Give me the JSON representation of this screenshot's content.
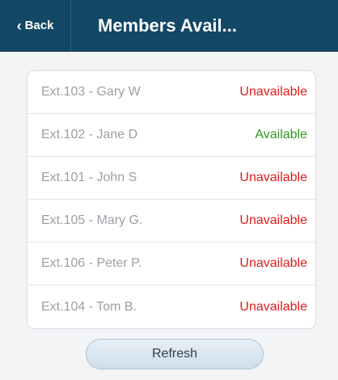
{
  "header": {
    "back_label": "Back",
    "back_glyph": "‹",
    "title": "Members Avail..."
  },
  "members": [
    {
      "name": "Ext.103 - Gary W",
      "status": "Unavailable",
      "status_color": "#e11c1c"
    },
    {
      "name": "Ext.102 - Jane D",
      "status": "Available",
      "status_color": "#2f9a1c"
    },
    {
      "name": "Ext.101 - John S",
      "status": "Unavailable",
      "status_color": "#e11c1c"
    },
    {
      "name": "Ext.105 - Mary G.",
      "status": "Unavailable",
      "status_color": "#e11c1c"
    },
    {
      "name": "Ext.106 - Peter P.",
      "status": "Unavailable",
      "status_color": "#e11c1c"
    },
    {
      "name": "Ext.104 - Tom B.",
      "status": "Unavailable",
      "status_color": "#e11c1c"
    }
  ],
  "refresh_label": "Refresh"
}
